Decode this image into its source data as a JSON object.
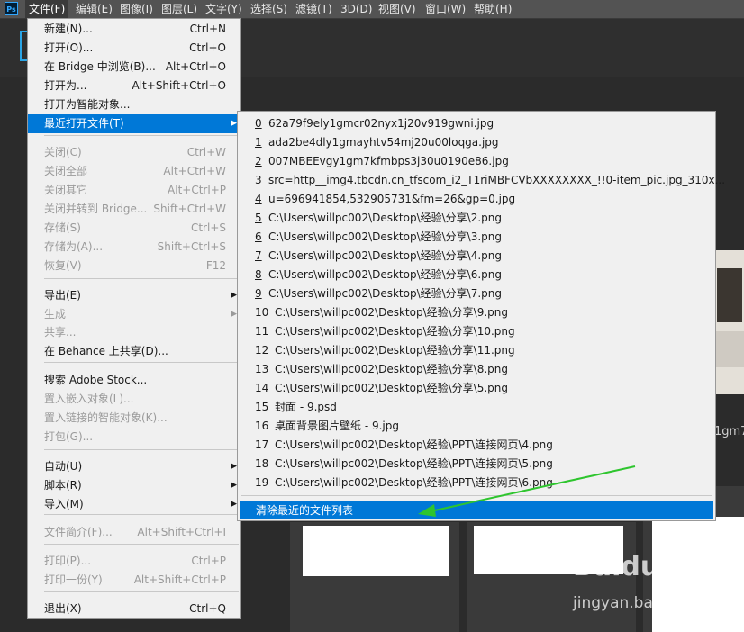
{
  "app": {
    "logo": "Ps"
  },
  "menubar": [
    {
      "label": "文件(F)",
      "active": true
    },
    {
      "label": "编辑(E)"
    },
    {
      "label": "图像(I)"
    },
    {
      "label": "图层(L)"
    },
    {
      "label": "文字(Y)"
    },
    {
      "label": "选择(S)"
    },
    {
      "label": "滤镜(T)"
    },
    {
      "label": "3D(D)"
    },
    {
      "label": "视图(V)"
    },
    {
      "label": "窗口(W)"
    },
    {
      "label": "帮助(H)"
    }
  ],
  "file_menu": [
    {
      "label": "新建(N)...",
      "shortcut": "Ctrl+N"
    },
    {
      "label": "打开(O)...",
      "shortcut": "Ctrl+O"
    },
    {
      "label": "在 Bridge 中浏览(B)...",
      "shortcut": "Alt+Ctrl+O"
    },
    {
      "label": "打开为...",
      "shortcut": "Alt+Shift+Ctrl+O"
    },
    {
      "label": "打开为智能对象...",
      "shortcut": ""
    },
    {
      "label": "最近打开文件(T)",
      "shortcut": "",
      "submenu": true,
      "highlighted": true
    },
    {
      "label": "关闭(C)",
      "shortcut": "Ctrl+W",
      "disabled": true
    },
    {
      "label": "关闭全部",
      "shortcut": "Alt+Ctrl+W",
      "disabled": true
    },
    {
      "label": "关闭其它",
      "shortcut": "Alt+Ctrl+P",
      "disabled": true
    },
    {
      "label": "关闭并转到 Bridge...",
      "shortcut": "Shift+Ctrl+W",
      "disabled": true
    },
    {
      "label": "存储(S)",
      "shortcut": "Ctrl+S",
      "disabled": true
    },
    {
      "label": "存储为(A)...",
      "shortcut": "Shift+Ctrl+S",
      "disabled": true
    },
    {
      "label": "恢复(V)",
      "shortcut": "F12",
      "disabled": true
    },
    {
      "label": "导出(E)",
      "shortcut": "",
      "submenu": true
    },
    {
      "label": "生成",
      "shortcut": "",
      "submenu": true,
      "disabled": true
    },
    {
      "label": "共享...",
      "shortcut": "",
      "disabled": true
    },
    {
      "label": "在 Behance 上共享(D)...",
      "shortcut": ""
    },
    {
      "label": "搜索 Adobe Stock...",
      "shortcut": ""
    },
    {
      "label": "置入嵌入对象(L)...",
      "shortcut": "",
      "disabled": true
    },
    {
      "label": "置入链接的智能对象(K)...",
      "shortcut": "",
      "disabled": true
    },
    {
      "label": "打包(G)...",
      "shortcut": "",
      "disabled": true
    },
    {
      "label": "自动(U)",
      "shortcut": "",
      "submenu": true
    },
    {
      "label": "脚本(R)",
      "shortcut": "",
      "submenu": true
    },
    {
      "label": "导入(M)",
      "shortcut": "",
      "submenu": true
    },
    {
      "label": "文件简介(F)...",
      "shortcut": "Alt+Shift+Ctrl+I",
      "disabled": true
    },
    {
      "label": "打印(P)...",
      "shortcut": "Ctrl+P",
      "disabled": true
    },
    {
      "label": "打印一份(Y)",
      "shortcut": "Alt+Shift+Ctrl+P",
      "disabled": true
    },
    {
      "label": "退出(X)",
      "shortcut": "Ctrl+Q"
    }
  ],
  "recent_files": [
    {
      "num": "0",
      "name": "62a79f9ely1gmcr02nyx1j20v919gwni.jpg"
    },
    {
      "num": "1",
      "name": "ada2be4dly1gmayhtv54mj20u00loqga.jpg"
    },
    {
      "num": "2",
      "name": "007MBEEvgy1gm7kfmbps3j30u0190e86.jpg"
    },
    {
      "num": "3",
      "name": "src=http__img4.tbcdn.cn_tfscom_i2_T1riMBFCVbXXXXXXXX_!!0-item_pic.jpg_310x..."
    },
    {
      "num": "4",
      "name": "u=696941854,532905731&fm=26&gp=0.jpg"
    },
    {
      "num": "5",
      "name": "C:\\Users\\willpc002\\Desktop\\经验\\分享\\2.png"
    },
    {
      "num": "6",
      "name": "C:\\Users\\willpc002\\Desktop\\经验\\分享\\3.png"
    },
    {
      "num": "7",
      "name": "C:\\Users\\willpc002\\Desktop\\经验\\分享\\4.png"
    },
    {
      "num": "8",
      "name": "C:\\Users\\willpc002\\Desktop\\经验\\分享\\6.png"
    },
    {
      "num": "9",
      "name": "C:\\Users\\willpc002\\Desktop\\经验\\分享\\7.png"
    },
    {
      "num": "10",
      "name": "C:\\Users\\willpc002\\Desktop\\经验\\分享\\9.png"
    },
    {
      "num": "11",
      "name": "C:\\Users\\willpc002\\Desktop\\经验\\分享\\10.png"
    },
    {
      "num": "12",
      "name": "C:\\Users\\willpc002\\Desktop\\经验\\分享\\11.png"
    },
    {
      "num": "13",
      "name": "C:\\Users\\willpc002\\Desktop\\经验\\分享\\8.png"
    },
    {
      "num": "14",
      "name": "C:\\Users\\willpc002\\Desktop\\经验\\分享\\5.png"
    },
    {
      "num": "15",
      "name": "封面 - 9.psd"
    },
    {
      "num": "16",
      "name": "桌面背景图片壁纸 - 9.jpg"
    },
    {
      "num": "17",
      "name": "C:\\Users\\willpc002\\Desktop\\经验\\PPT\\连接网页\\4.png"
    },
    {
      "num": "18",
      "name": "C:\\Users\\willpc002\\Desktop\\经验\\PPT\\连接网页\\5.png"
    },
    {
      "num": "19",
      "name": "C:\\Users\\willpc002\\Desktop\\经验\\PPT\\连接网页\\6.png"
    }
  ],
  "clear_recent_label": "清除最近的文件列表",
  "background": {
    "thumbnail_caption": "1gm7"
  },
  "watermark": {
    "brand": "Baidu",
    "sub": "jingyan.baidu.com"
  },
  "colors": {
    "highlight": "#0078d7",
    "annotation_arrow": "#2ec52e",
    "ps_blue": "#31a8ff"
  }
}
